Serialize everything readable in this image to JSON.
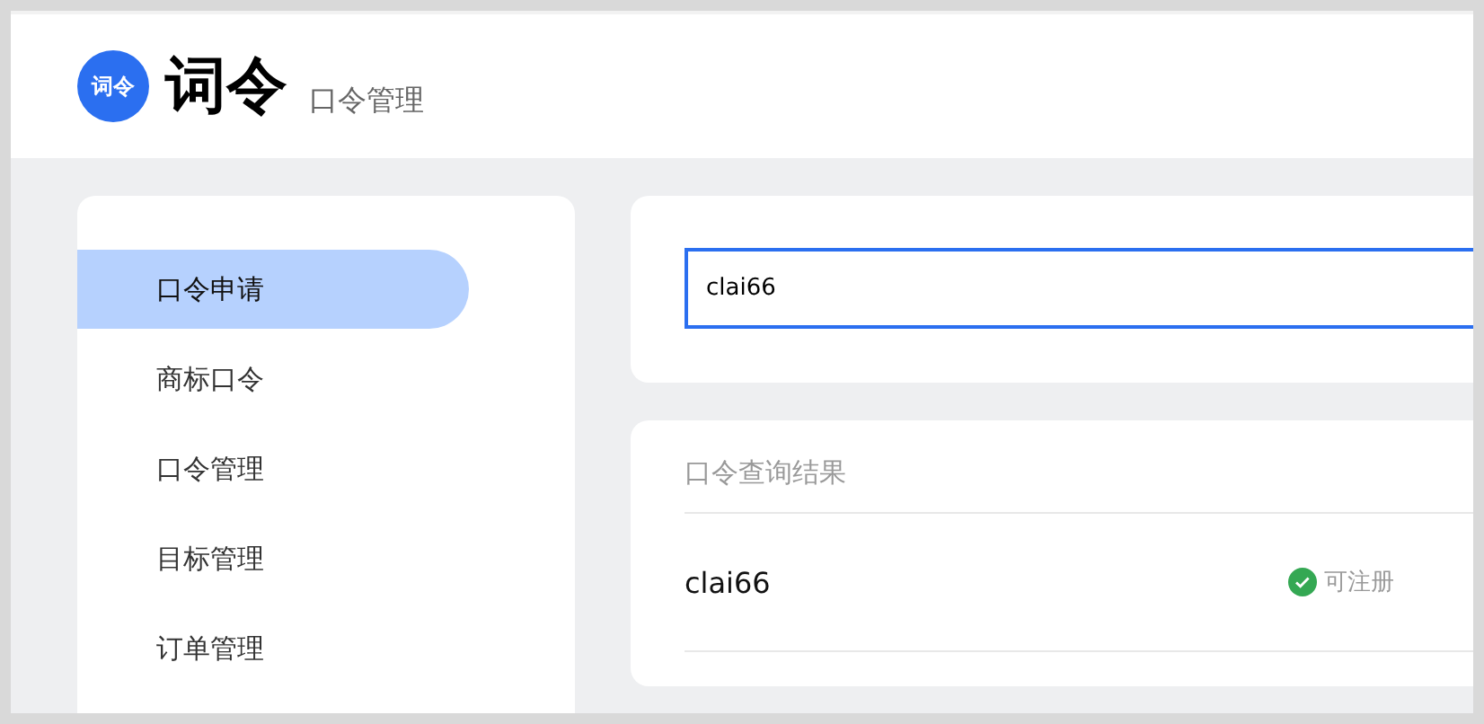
{
  "header": {
    "logo_text": "词令",
    "title": "词令",
    "subtitle": "口令管理"
  },
  "sidebar": {
    "items": [
      {
        "label": "口令申请",
        "selected": true
      },
      {
        "label": "商标口令",
        "selected": false
      },
      {
        "label": "口令管理",
        "selected": false
      },
      {
        "label": "目标管理",
        "selected": false
      },
      {
        "label": "订单管理",
        "selected": false
      }
    ]
  },
  "search": {
    "value": "clai66"
  },
  "results": {
    "title": "口令查询结果",
    "rows": [
      {
        "name": "clai66",
        "status": {
          "kind": "available",
          "label": "可注册",
          "color": "#34a853"
        }
      }
    ]
  }
}
